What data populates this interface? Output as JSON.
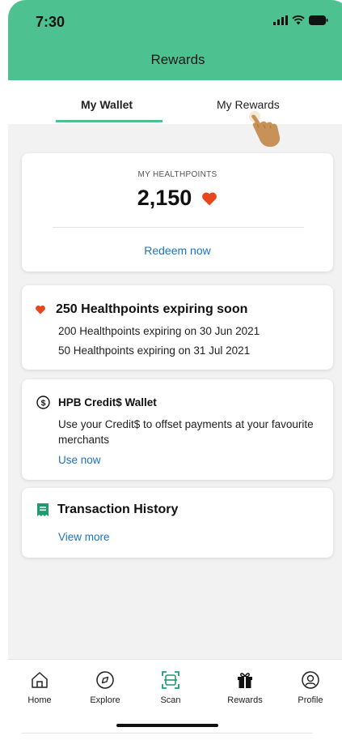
{
  "status_bar": {
    "time": "7:30"
  },
  "header": {
    "title": "Rewards"
  },
  "tabs": [
    {
      "label": "My Wallet",
      "active": true
    },
    {
      "label": "My Rewards",
      "active": false
    }
  ],
  "healthpoints": {
    "label": "MY HEALTHPOINTS",
    "value": "2,150",
    "action": "Redeem now"
  },
  "expiring": {
    "title": "250 Healthpoints expiring soon",
    "lines": [
      "200 Healthpoints expiring on 30 Jun 2021",
      "50 Healthpoints expiring on 31 Jul 2021"
    ]
  },
  "credit_wallet": {
    "title": "HPB Credit$ Wallet",
    "description": "Use your Credit$ to offset payments at your favourite merchants",
    "action": "Use now"
  },
  "transactions": {
    "title": "Transaction History",
    "action": "View more"
  },
  "bottom_nav": [
    {
      "label": "Home",
      "icon": "home-icon"
    },
    {
      "label": "Explore",
      "icon": "compass-icon"
    },
    {
      "label": "Scan",
      "icon": "scan-icon"
    },
    {
      "label": "Rewards",
      "icon": "gift-icon"
    },
    {
      "label": "Profile",
      "icon": "profile-icon"
    }
  ],
  "colors": {
    "brand_green": "#4dc18f",
    "link_blue": "#1a73c9",
    "heart_red": "#e8461c"
  }
}
